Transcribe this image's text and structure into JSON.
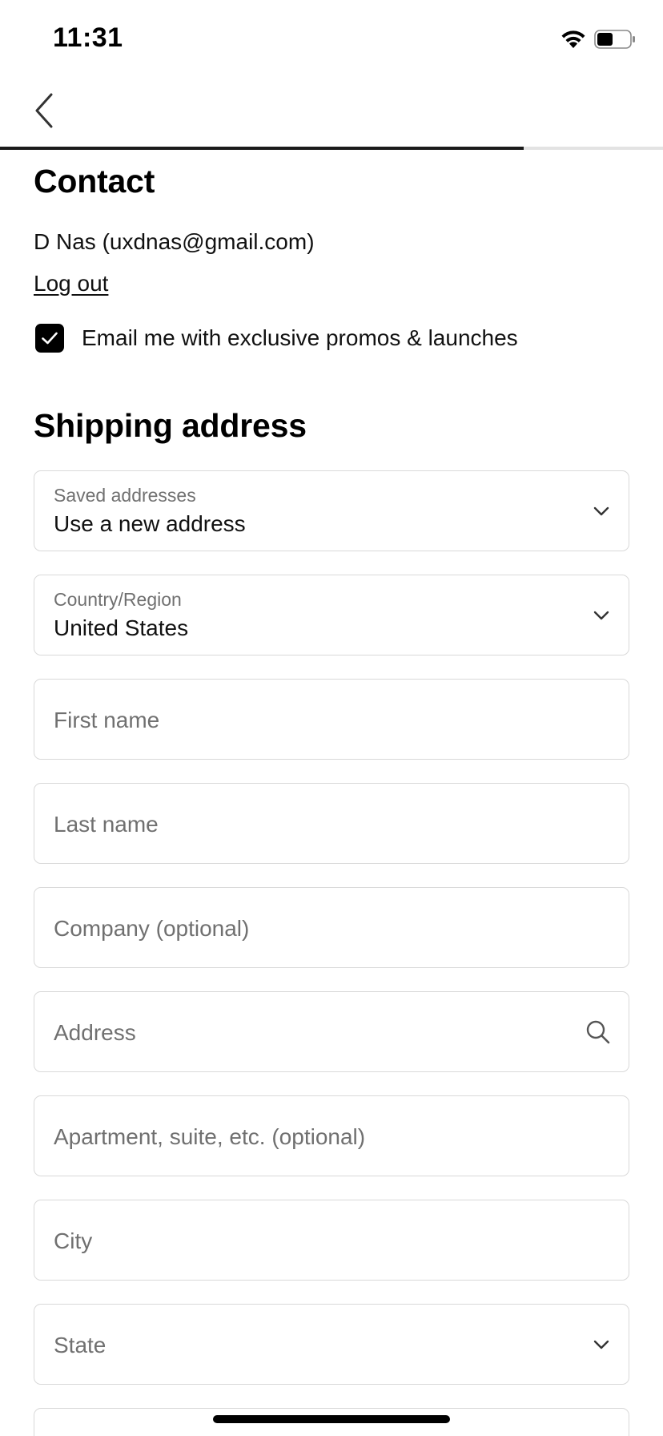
{
  "status_bar": {
    "time": "11:31"
  },
  "progress": {
    "fraction": 0.79
  },
  "contact": {
    "title": "Contact",
    "user_line": "D Nas (uxdnas@gmail.com)",
    "logout_label": "Log out",
    "email_optin_label": "Email me with exclusive promos & launches",
    "email_optin_checked": true
  },
  "shipping": {
    "title": "Shipping address",
    "saved_addresses": {
      "label": "Saved addresses",
      "value": "Use a new address"
    },
    "country": {
      "label": "Country/Region",
      "value": "United States"
    },
    "first_name": {
      "placeholder": "First name"
    },
    "last_name": {
      "placeholder": "Last name"
    },
    "company": {
      "placeholder": "Company (optional)"
    },
    "address": {
      "placeholder": "Address"
    },
    "apartment": {
      "placeholder": "Apartment, suite, etc. (optional)"
    },
    "city": {
      "placeholder": "City"
    },
    "state": {
      "placeholder": "State"
    }
  },
  "icons": {
    "back": "chevron-left-icon",
    "dropdown": "chevron-down-icon",
    "search": "search-icon",
    "check": "checkmark-icon"
  },
  "colors": {
    "accent": "#000000",
    "border": "#d9d9d9",
    "placeholder": "#707070"
  }
}
